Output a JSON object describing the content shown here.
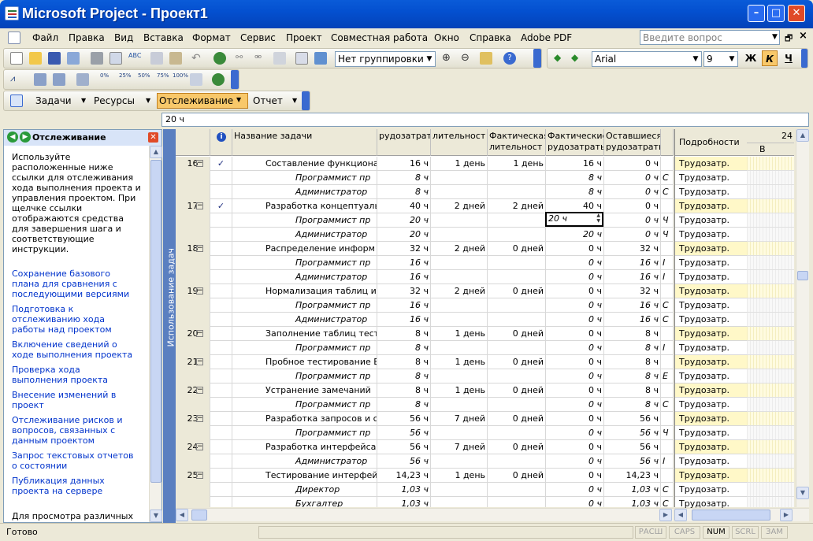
{
  "window": {
    "title": "Microsoft Project - Проект1"
  },
  "menu": {
    "items": [
      "Файл",
      "Правка",
      "Вид",
      "Вставка",
      "Формат",
      "Сервис",
      "Проект",
      "Совместная работа",
      "Окно",
      "Справка",
      "Adobe PDF"
    ],
    "help_placeholder": "Введите вопрос"
  },
  "toolbar": {
    "grouping": "Нет группировки",
    "font": "Arial",
    "font_size": "9",
    "bold": "Ж",
    "italic": "К",
    "underline": "Ч",
    "progress_labels": [
      "0%",
      "25%",
      "50%",
      "75%",
      "100%"
    ]
  },
  "view_toolbar": {
    "tasks": "Задачи",
    "resources": "Ресурсы",
    "tracking": "Отслеживание",
    "report": "Отчет"
  },
  "entry_bar": {
    "value": "20 ч"
  },
  "side_pane": {
    "title": "Отслеживание",
    "intro": "Используйте расположенные ниже ссылки для отслеживания хода выполнения проекта и управления проектом. При щелчке ссылки отображаются средства для завершения шага и соответствующие инструкции.",
    "links": [
      "Сохранение базового плана для сравнения с последующими версиями",
      "Подготовка к отслеживанию хода работы над проектом",
      "Включение сведений о ходе выполнения проекта",
      "Проверка хода выполнения проекта",
      "Внесение изменений в проект",
      "Отслеживание рисков и вопросов, связанных с данным проектом",
      "Запрос текстовых отчетов о состоянии",
      "Публикация данных проекта на сервере"
    ],
    "footer": "Для просмотра различных"
  },
  "vertical_label": "Использование задач",
  "grid": {
    "columns": [
      "",
      "i",
      "Название задачи",
      "Трудозатраты",
      "Длительность",
      "Фактическая длительность",
      "Фактические трудозатраты",
      "Оставшиеся трудозатраты",
      ""
    ],
    "column_display": [
      "",
      "",
      "Название задачи",
      "рудозатрат",
      "лительност",
      "Фактическая\nлительност",
      "Фактические\nрудозатрать",
      "Оставшиеся\nрудозатрать",
      ""
    ],
    "rows": [
      {
        "id": "16",
        "check": "✓",
        "name": "Составление функциона",
        "work": "16 ч",
        "dur": "1 день",
        "adur": "1 день",
        "awork": "16 ч",
        "rem": "0 ч",
        "x": "",
        "task": true
      },
      {
        "id": "",
        "check": "",
        "name": "Программист пр",
        "work": "8 ч",
        "dur": "",
        "adur": "",
        "awork": "8 ч",
        "rem": "0 ч",
        "x": "С",
        "task": false
      },
      {
        "id": "",
        "check": "",
        "name": "Администратор",
        "work": "8 ч",
        "dur": "",
        "adur": "",
        "awork": "8 ч",
        "rem": "0 ч",
        "x": "С",
        "task": false
      },
      {
        "id": "17",
        "check": "✓",
        "name": "Разработка концептуаль",
        "work": "40 ч",
        "dur": "2 дней",
        "adur": "2 дней",
        "awork": "40 ч",
        "rem": "0 ч",
        "x": "",
        "task": true
      },
      {
        "id": "",
        "check": "",
        "name": "Программист пр",
        "work": "20 ч",
        "dur": "",
        "adur": "",
        "awork": "20 ч",
        "rem": "0 ч",
        "x": "Ч",
        "task": false
      },
      {
        "id": "",
        "check": "",
        "name": "Администратор",
        "work": "20 ч",
        "dur": "",
        "adur": "",
        "awork": "20 ч",
        "rem": "0 ч",
        "x": "Ч",
        "task": false
      },
      {
        "id": "18",
        "check": "",
        "name": "Распределение информ",
        "work": "32 ч",
        "dur": "2 дней",
        "adur": "0 дней",
        "awork": "0 ч",
        "rem": "32 ч",
        "x": "",
        "task": true
      },
      {
        "id": "",
        "check": "",
        "name": "Программист пр",
        "work": "16 ч",
        "dur": "",
        "adur": "",
        "awork": "0 ч",
        "rem": "16 ч",
        "x": "I",
        "task": false
      },
      {
        "id": "",
        "check": "",
        "name": "Администратор",
        "work": "16 ч",
        "dur": "",
        "adur": "",
        "awork": "0 ч",
        "rem": "16 ч",
        "x": "I",
        "task": false
      },
      {
        "id": "19",
        "check": "",
        "name": "Нормализация таблиц и",
        "work": "32 ч",
        "dur": "2 дней",
        "adur": "0 дней",
        "awork": "0 ч",
        "rem": "32 ч",
        "x": "",
        "task": true
      },
      {
        "id": "",
        "check": "",
        "name": "Программист пр",
        "work": "16 ч",
        "dur": "",
        "adur": "",
        "awork": "0 ч",
        "rem": "16 ч",
        "x": "С",
        "task": false
      },
      {
        "id": "",
        "check": "",
        "name": "Администратор",
        "work": "16 ч",
        "dur": "",
        "adur": "",
        "awork": "0 ч",
        "rem": "16 ч",
        "x": "С",
        "task": false
      },
      {
        "id": "20",
        "check": "",
        "name": "Заполнение таблиц тест",
        "work": "8 ч",
        "dur": "1 день",
        "adur": "0 дней",
        "awork": "0 ч",
        "rem": "8 ч",
        "x": "",
        "task": true
      },
      {
        "id": "",
        "check": "",
        "name": "Программист пр",
        "work": "8 ч",
        "dur": "",
        "adur": "",
        "awork": "0 ч",
        "rem": "8 ч",
        "x": "I",
        "task": false
      },
      {
        "id": "21",
        "check": "",
        "name": "Пробное тестирование Б",
        "work": "8 ч",
        "dur": "1 день",
        "adur": "0 дней",
        "awork": "0 ч",
        "rem": "8 ч",
        "x": "",
        "task": true
      },
      {
        "id": "",
        "check": "",
        "name": "Программист пр",
        "work": "8 ч",
        "dur": "",
        "adur": "",
        "awork": "0 ч",
        "rem": "8 ч",
        "x": "Е",
        "task": false
      },
      {
        "id": "22",
        "check": "",
        "name": "Устранение замечаний",
        "work": "8 ч",
        "dur": "1 день",
        "adur": "0 дней",
        "awork": "0 ч",
        "rem": "8 ч",
        "x": "",
        "task": true
      },
      {
        "id": "",
        "check": "",
        "name": "Программист пр",
        "work": "8 ч",
        "dur": "",
        "adur": "",
        "awork": "0 ч",
        "rem": "8 ч",
        "x": "С",
        "task": false
      },
      {
        "id": "23",
        "check": "",
        "name": "Разработка запросов и с",
        "work": "56 ч",
        "dur": "7 дней",
        "adur": "0 дней",
        "awork": "0 ч",
        "rem": "56 ч",
        "x": "",
        "task": true
      },
      {
        "id": "",
        "check": "",
        "name": "Программист пр",
        "work": "56 ч",
        "dur": "",
        "adur": "",
        "awork": "0 ч",
        "rem": "56 ч",
        "x": "Ч",
        "task": false
      },
      {
        "id": "24",
        "check": "",
        "name": "Разработка интерфейса",
        "work": "56 ч",
        "dur": "7 дней",
        "adur": "0 дней",
        "awork": "0 ч",
        "rem": "56 ч",
        "x": "",
        "task": true
      },
      {
        "id": "",
        "check": "",
        "name": "Администратор",
        "work": "56 ч",
        "dur": "",
        "adur": "",
        "awork": "0 ч",
        "rem": "56 ч",
        "x": "I",
        "task": false
      },
      {
        "id": "25",
        "check": "",
        "name": "Тестирование интерфей",
        "work": "14,23 ч",
        "dur": "1 день",
        "adur": "0 дней",
        "awork": "0 ч",
        "rem": "14,23 ч",
        "x": "",
        "task": true
      },
      {
        "id": "",
        "check": "",
        "name": "Директор",
        "work": "1,03 ч",
        "dur": "",
        "adur": "",
        "awork": "0 ч",
        "rem": "1,03 ч",
        "x": "С",
        "task": false
      },
      {
        "id": "",
        "check": "",
        "name": "Бухгалтер",
        "work": "1,03 ч",
        "dur": "",
        "adur": "",
        "awork": "0 ч",
        "rem": "1,03 ч",
        "x": "С",
        "task": false
      }
    ],
    "edit_value": "20 ч"
  },
  "details": {
    "header": "Подробности",
    "label": "Трудозатр."
  },
  "timescale": {
    "top": "24",
    "day": "В"
  },
  "status": {
    "left": "Готово",
    "indicators": [
      "РАСШ",
      "CAPS",
      "NUM",
      "SCRL",
      "ЗАМ"
    ],
    "active": [
      "NUM"
    ]
  },
  "colors": {
    "title": "#0450d0",
    "tracking_active": "#f8c86a",
    "details_highlight": "#fff8c8",
    "link": "#0033cc"
  }
}
